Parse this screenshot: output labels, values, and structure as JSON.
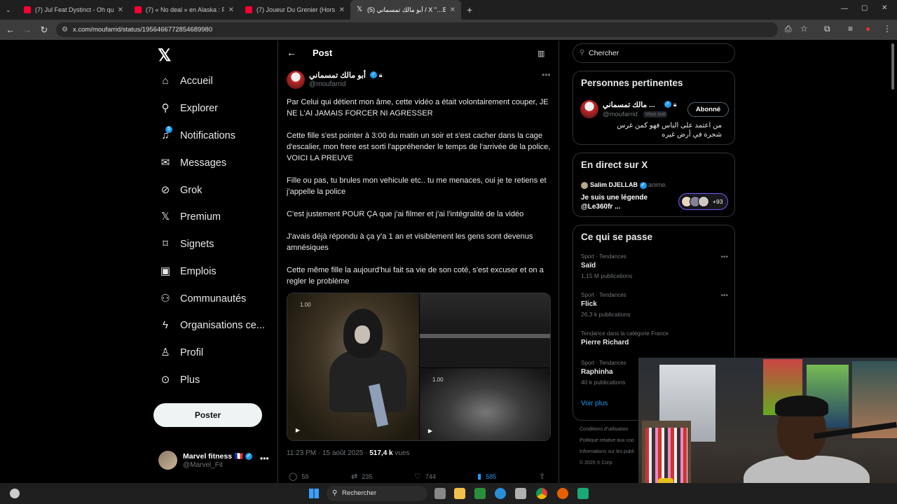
{
  "tabs": [
    {
      "title": "(7) Jul Feat Dystinct - Oh qu'elle",
      "favicon": "youtube-icon"
    },
    {
      "title": "(7) « No deal » en Alaska : Pout",
      "favicon": "youtube-icon"
    },
    {
      "title": "(7) Joueur Du Grenier (Hors-sé",
      "favicon": "youtube-icon"
    },
    {
      "title": "(5) أبو مالك تمسماني / X \"…EF",
      "favicon": "x-icon",
      "active": true
    }
  ],
  "address": {
    "url": "x.com/moufarrid/status/1956466772854689980"
  },
  "nav": {
    "items": [
      {
        "label": "Accueil",
        "icon": "home-icon"
      },
      {
        "label": "Explorer",
        "icon": "search-icon"
      },
      {
        "label": "Notifications",
        "icon": "bell-icon",
        "badge": "5"
      },
      {
        "label": "Messages",
        "icon": "envelope-icon"
      },
      {
        "label": "Grok",
        "icon": "grok-icon"
      },
      {
        "label": "Premium",
        "icon": "x-icon"
      },
      {
        "label": "Signets",
        "icon": "bookmark-icon"
      },
      {
        "label": "Emplois",
        "icon": "briefcase-icon"
      },
      {
        "label": "Communautés",
        "icon": "people-icon"
      },
      {
        "label": "Organisations ce...",
        "icon": "lightning-icon"
      },
      {
        "label": "Profil",
        "icon": "person-icon"
      },
      {
        "label": "Plus",
        "icon": "more-circle-icon"
      }
    ],
    "post_button": "Poster"
  },
  "account": {
    "name": "Marvel fitness 🇫🇷",
    "handle": "@Marvel_Fit"
  },
  "header": {
    "title": "Post"
  },
  "post": {
    "author_name": "أبو مالك تمسماني",
    "author_handle": "@moufarrid",
    "paragraphs": [
      "Par Celui qui détient mon âme, cette vidéo a était volontairement couper, JE NE L'AI JAMAIS FORCER NI AGRESSER",
      "Cette fille s'est pointer à 3:00 du matin un soir et s'est cacher dans la cage d'escalier, mon frere est sorti l'appréhender le temps de l'arrivée de la police, VOICI LA PREUVE",
      "Fille ou pas, tu brules mon vehicule etc.. tu me menaces, oui je te retiens et j'appelle la police",
      "C'est justement POUR ÇA que j'ai filmer et j'ai l'intégralité de la vidéo",
      "J'avais déjà répondu à ça y'a 1 an et visiblement les gens sont devenus amnésiques",
      "Cette même fille la aujourd'hui fait sa vie de son coté, s'est excuser et on a regler le problème"
    ],
    "media_timestamps": [
      "1.00",
      "1.00"
    ],
    "time": "11:23 PM · 15 août 2025 · ",
    "views_count": "517,4 k",
    "views_label": " vues",
    "replies": "59",
    "reposts": "235",
    "likes": "744",
    "bookmarks": "585"
  },
  "search": {
    "placeholder": "Chercher"
  },
  "related": {
    "title": "Personnes pertinentes",
    "name": "... مالك تمسماني",
    "handle": "@moufarrid",
    "follows_you": "Vous suit",
    "button": "Abonné",
    "bio": "من اعتمد على الناس فهو كمن غرس شجرة في أرض غيره"
  },
  "live": {
    "title": "En direct sur X",
    "host": "Salim DJELLAB",
    "host_action": " anime.",
    "space_title": "Je suis une légende @Le360fr ...",
    "listeners": "+93"
  },
  "trends": {
    "title": "Ce qui se passe",
    "items": [
      {
        "category": "Sport · Tendances",
        "name": "Saïd",
        "count": "1,15 M publications"
      },
      {
        "category": "Sport · Tendances",
        "name": "Flick",
        "count": "26,3 k publications"
      },
      {
        "category": "Tendance dans la catégorie France",
        "name": "Pierre Richard",
        "count": ""
      },
      {
        "category": "Sport · Tendances",
        "name": "Raphinha",
        "count": "40 k publications"
      }
    ],
    "see_more": "Voir plus"
  },
  "footer": {
    "links": [
      "Conditions d'utilisation",
      "Politique relative aux coo",
      "Informations sur les publi",
      "© 2025 X Corp."
    ]
  },
  "taskbar": {
    "search": "Rechercher"
  }
}
